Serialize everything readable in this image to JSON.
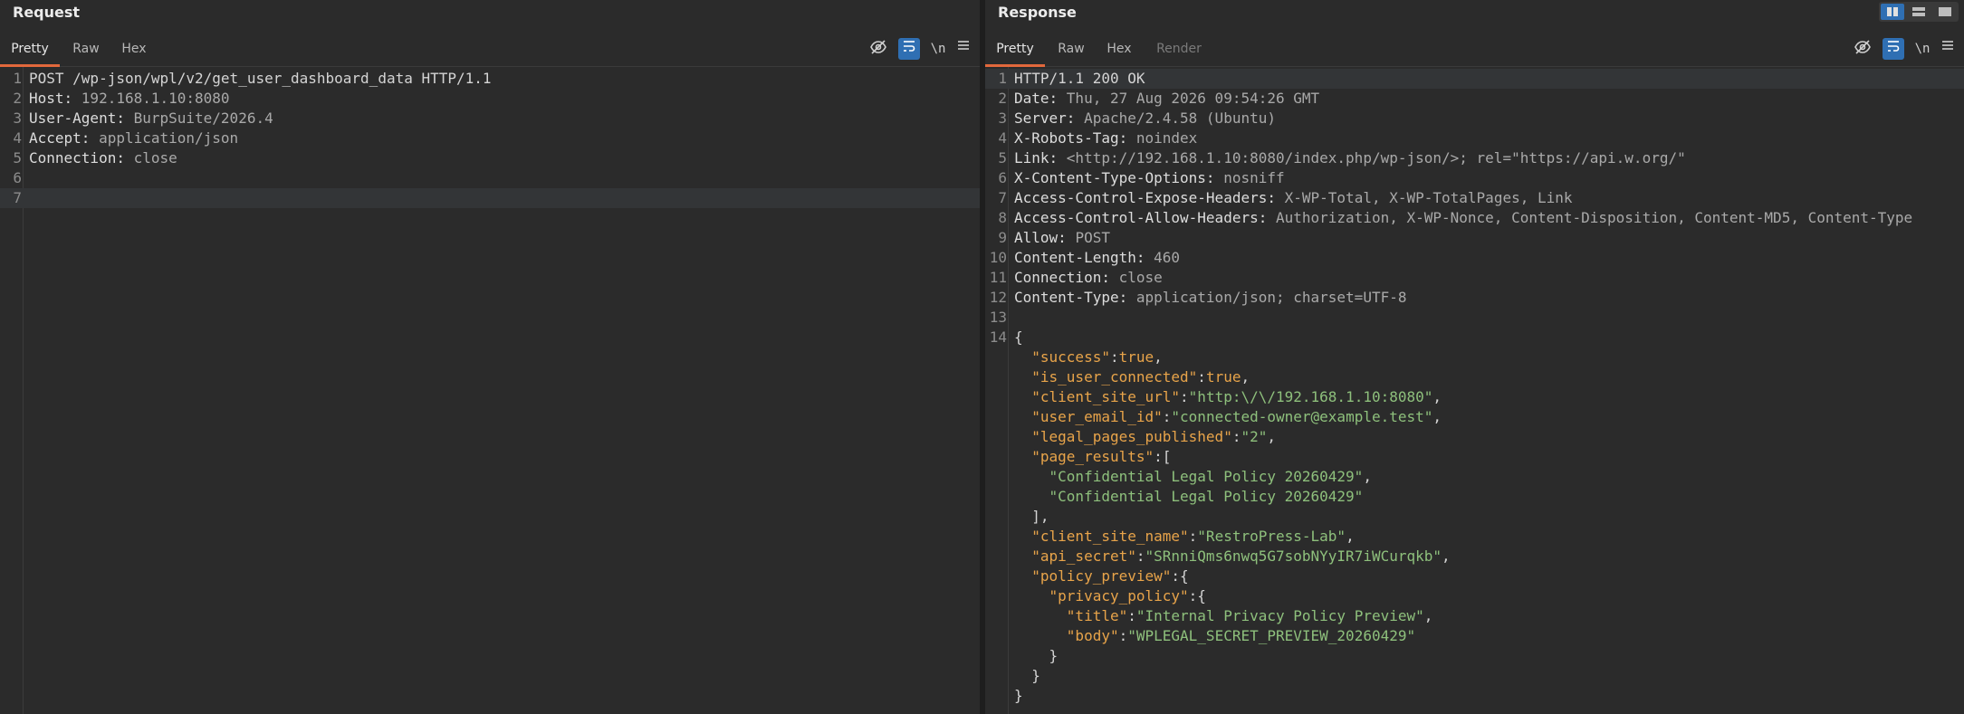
{
  "request": {
    "title": "Request",
    "tabs": [
      "Pretty",
      "Raw",
      "Hex"
    ],
    "active_tab": "Pretty",
    "lines": [
      {
        "n": "1",
        "parts": [
          [
            "plain",
            "POST /wp-json/wpl/v2/get_user_dashboard_data HTTP/1.1"
          ]
        ]
      },
      {
        "n": "2",
        "parts": [
          [
            "hname",
            "Host: "
          ],
          [
            "hval",
            "192.168.1.10:8080"
          ]
        ]
      },
      {
        "n": "3",
        "parts": [
          [
            "hname",
            "User-Agent: "
          ],
          [
            "hval",
            "BurpSuite/2026.4"
          ]
        ]
      },
      {
        "n": "4",
        "parts": [
          [
            "hname",
            "Accept: "
          ],
          [
            "hval",
            "application/json"
          ]
        ]
      },
      {
        "n": "5",
        "parts": [
          [
            "hname",
            "Connection: "
          ],
          [
            "hval",
            "close"
          ]
        ]
      },
      {
        "n": "6",
        "parts": []
      },
      {
        "n": "7",
        "parts": [],
        "highlight": true
      }
    ]
  },
  "response": {
    "title": "Response",
    "tabs": [
      "Pretty",
      "Raw",
      "Hex",
      "Render"
    ],
    "active_tab": "Pretty",
    "lines": [
      {
        "n": "1",
        "parts": [
          [
            "plain",
            "HTTP/1.1 200 OK"
          ]
        ],
        "highlight": true
      },
      {
        "n": "2",
        "parts": [
          [
            "hname",
            "Date: "
          ],
          [
            "hval",
            "Thu, 27 Aug 2026 09:54:26 GMT"
          ]
        ]
      },
      {
        "n": "3",
        "parts": [
          [
            "hname",
            "Server: "
          ],
          [
            "hval",
            "Apache/2.4.58 (Ubuntu)"
          ]
        ]
      },
      {
        "n": "4",
        "parts": [
          [
            "hname",
            "X-Robots-Tag: "
          ],
          [
            "hval",
            "noindex"
          ]
        ]
      },
      {
        "n": "5",
        "parts": [
          [
            "hname",
            "Link: "
          ],
          [
            "hval",
            "<http://192.168.1.10:8080/index.php/wp-json/>; rel=\"https://api.w.org/\""
          ]
        ]
      },
      {
        "n": "6",
        "parts": [
          [
            "hname",
            "X-Content-Type-Options: "
          ],
          [
            "hval",
            "nosniff"
          ]
        ]
      },
      {
        "n": "7",
        "parts": [
          [
            "hname",
            "Access-Control-Expose-Headers: "
          ],
          [
            "hval",
            "X-WP-Total, X-WP-TotalPages, Link"
          ]
        ]
      },
      {
        "n": "8",
        "parts": [
          [
            "hname",
            "Access-Control-Allow-Headers: "
          ],
          [
            "hval",
            "Authorization, X-WP-Nonce, Content-Disposition, Content-MD5, Content-Type"
          ]
        ]
      },
      {
        "n": "9",
        "parts": [
          [
            "hname",
            "Allow: "
          ],
          [
            "hval",
            "POST"
          ]
        ]
      },
      {
        "n": "10",
        "parts": [
          [
            "hname",
            "Content-Length: "
          ],
          [
            "hval",
            "460"
          ]
        ]
      },
      {
        "n": "11",
        "parts": [
          [
            "hname",
            "Connection: "
          ],
          [
            "hval",
            "close"
          ]
        ]
      },
      {
        "n": "12",
        "parts": [
          [
            "hname",
            "Content-Type: "
          ],
          [
            "hval",
            "application/json; charset=UTF-8"
          ]
        ]
      },
      {
        "n": "13",
        "parts": []
      },
      {
        "n": "14",
        "parts": [
          [
            "punct",
            "{"
          ]
        ]
      },
      {
        "n": "",
        "parts": [
          [
            "punct",
            "  "
          ],
          [
            "key",
            "\"success\""
          ],
          [
            "punct",
            ":"
          ],
          [
            "bool",
            "true"
          ],
          [
            "punct",
            ","
          ]
        ]
      },
      {
        "n": "",
        "parts": [
          [
            "punct",
            "  "
          ],
          [
            "key",
            "\"is_user_connected\""
          ],
          [
            "punct",
            ":"
          ],
          [
            "bool",
            "true"
          ],
          [
            "punct",
            ","
          ]
        ]
      },
      {
        "n": "",
        "parts": [
          [
            "punct",
            "  "
          ],
          [
            "key",
            "\"client_site_url\""
          ],
          [
            "punct",
            ":"
          ],
          [
            "str",
            "\"http:\\/\\/192.168.1.10:8080\""
          ],
          [
            "punct",
            ","
          ]
        ]
      },
      {
        "n": "",
        "parts": [
          [
            "punct",
            "  "
          ],
          [
            "key",
            "\"user_email_id\""
          ],
          [
            "punct",
            ":"
          ],
          [
            "str",
            "\"connected-owner@example.test\""
          ],
          [
            "punct",
            ","
          ]
        ]
      },
      {
        "n": "",
        "parts": [
          [
            "punct",
            "  "
          ],
          [
            "key",
            "\"legal_pages_published\""
          ],
          [
            "punct",
            ":"
          ],
          [
            "str",
            "\"2\""
          ],
          [
            "punct",
            ","
          ]
        ]
      },
      {
        "n": "",
        "parts": [
          [
            "punct",
            "  "
          ],
          [
            "key",
            "\"page_results\""
          ],
          [
            "punct",
            ":["
          ]
        ]
      },
      {
        "n": "",
        "parts": [
          [
            "punct",
            "    "
          ],
          [
            "str",
            "\"Confidential Legal Policy 20260429\""
          ],
          [
            "punct",
            ","
          ]
        ]
      },
      {
        "n": "",
        "parts": [
          [
            "punct",
            "    "
          ],
          [
            "str",
            "\"Confidential Legal Policy 20260429\""
          ]
        ]
      },
      {
        "n": "",
        "parts": [
          [
            "punct",
            "  ],"
          ]
        ]
      },
      {
        "n": "",
        "parts": [
          [
            "punct",
            "  "
          ],
          [
            "key",
            "\"client_site_name\""
          ],
          [
            "punct",
            ":"
          ],
          [
            "str",
            "\"RestroPress-Lab\""
          ],
          [
            "punct",
            ","
          ]
        ]
      },
      {
        "n": "",
        "parts": [
          [
            "punct",
            "  "
          ],
          [
            "key",
            "\"api_secret\""
          ],
          [
            "punct",
            ":"
          ],
          [
            "str",
            "\"SRnniQms6nwq5G7sobNYyIR7iWCurqkb\""
          ],
          [
            "punct",
            ","
          ]
        ]
      },
      {
        "n": "",
        "parts": [
          [
            "punct",
            "  "
          ],
          [
            "key",
            "\"policy_preview\""
          ],
          [
            "punct",
            ":{"
          ]
        ]
      },
      {
        "n": "",
        "parts": [
          [
            "punct",
            "    "
          ],
          [
            "key",
            "\"privacy_policy\""
          ],
          [
            "punct",
            ":{"
          ]
        ]
      },
      {
        "n": "",
        "parts": [
          [
            "punct",
            "      "
          ],
          [
            "key",
            "\"title\""
          ],
          [
            "punct",
            ":"
          ],
          [
            "str",
            "\"Internal Privacy Policy Preview\""
          ],
          [
            "punct",
            ","
          ]
        ]
      },
      {
        "n": "",
        "parts": [
          [
            "punct",
            "      "
          ],
          [
            "key",
            "\"body\""
          ],
          [
            "punct",
            ":"
          ],
          [
            "str",
            "\"WPLEGAL_SECRET_PREVIEW_20260429\""
          ]
        ]
      },
      {
        "n": "",
        "parts": [
          [
            "punct",
            "    }"
          ]
        ]
      },
      {
        "n": "",
        "parts": [
          [
            "punct",
            "  }"
          ]
        ]
      },
      {
        "n": "",
        "parts": [
          [
            "punct",
            "}"
          ]
        ]
      }
    ]
  },
  "toolbar": {
    "hide_icon": "eye-slash-icon",
    "wrap_icon": "word-wrap-icon",
    "newline_label": "\\n",
    "menu_icon": "hamburger-menu-icon"
  },
  "colors": {
    "accent_tab": "#e2683c",
    "toggle_on": "#2f6fb3",
    "json_key": "#e8a44a",
    "json_string": "#8ec07c"
  }
}
